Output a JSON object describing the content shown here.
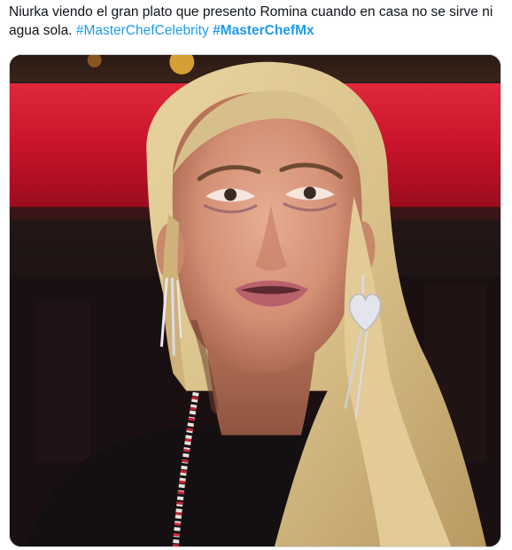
{
  "tweet": {
    "text_plain": "Niurka viendo el gran plato que presento Romina cuando en casa no se sirve ni agua sola.",
    "hashtag_1": "#MasterChefCelebrity",
    "hashtag_2": "#MasterChefMx"
  },
  "media": {
    "icon": "photo-of-crying-woman",
    "colors": {
      "hashtag": "#1d9bf0",
      "background_red": "#c8142a",
      "hair_blonde": "#d9c089"
    }
  }
}
